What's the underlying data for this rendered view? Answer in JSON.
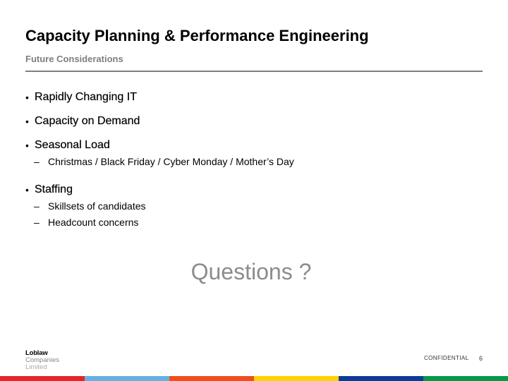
{
  "slide": {
    "title": "Capacity Planning & Performance Engineering",
    "subtitle": "Future Considerations",
    "bullets": [
      {
        "text": "Rapidly Changing IT",
        "subs": []
      },
      {
        "text": "Capacity on Demand",
        "subs": []
      },
      {
        "text": "Seasonal Load",
        "subs": [
          "Christmas / Black Friday / Cyber Monday / Mother’s Day"
        ]
      },
      {
        "text": "Staffing",
        "subs": [
          "Skillsets of candidates",
          "Headcount concerns"
        ]
      }
    ],
    "bullet_glyph": "•",
    "sub_glyph": "–",
    "questions": "Questions ?"
  },
  "footer": {
    "logo_lines": [
      "Loblaw",
      "Companies",
      "Limited"
    ],
    "confidential": "CONFIDENTIAL",
    "page_number": "6",
    "color_bar": [
      "#e52329",
      "#64b1e2",
      "#f04e1d",
      "#fed201",
      "#0a3c9a",
      "#06994a"
    ]
  }
}
